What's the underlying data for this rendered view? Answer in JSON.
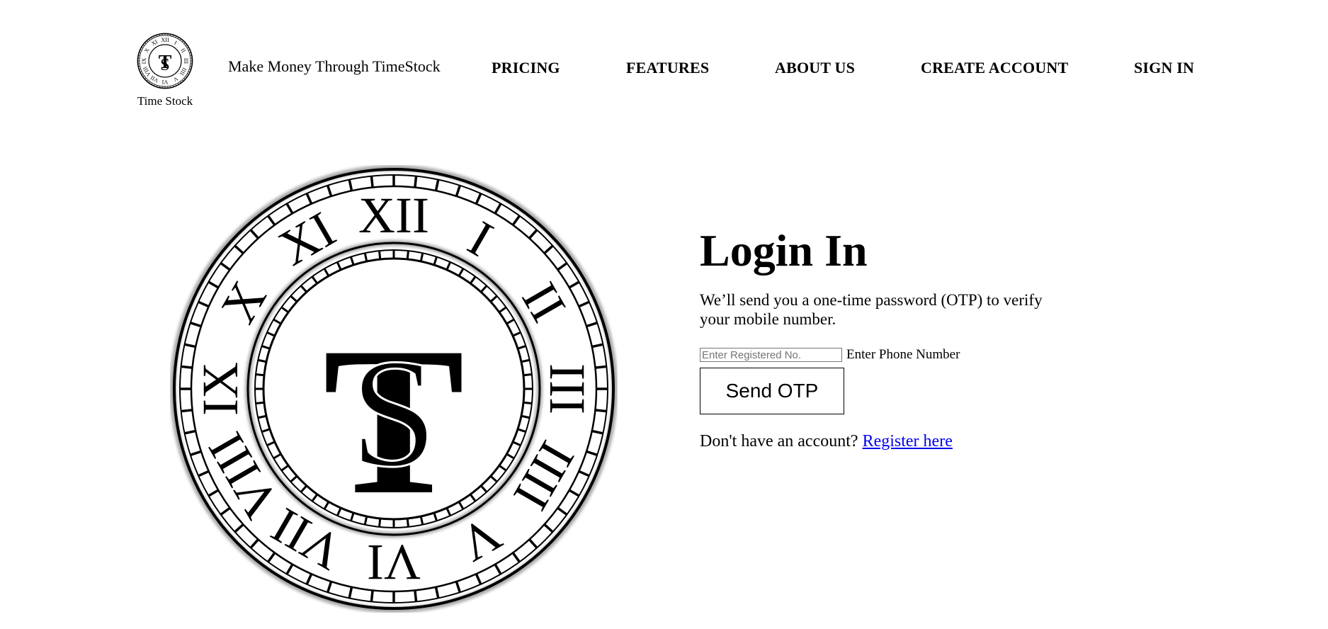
{
  "header": {
    "logo_text": "Time Stock",
    "logo_monogram": "TS",
    "tagline": "Make Money Through TimeStock",
    "nav": [
      {
        "label": "PRICING"
      },
      {
        "label": "FEATURES"
      },
      {
        "label": "ABOUT US"
      },
      {
        "label": "CREATE ACCOUNT"
      },
      {
        "label": "SIGN IN"
      }
    ]
  },
  "hero": {
    "numerals": [
      "XII",
      "I",
      "II",
      "III",
      "IIII",
      "V",
      "VI",
      "VII",
      "VIII",
      "IX",
      "X",
      "XI"
    ]
  },
  "login": {
    "title": "Login In",
    "description": "We’ll send you a one-time password (OTP) to verify your mobile number.",
    "phone_placeholder": "Enter Registered No.",
    "phone_value": "",
    "phone_label": "Enter Phone Number",
    "send_button": "Send OTP",
    "no_account_text": "Don't have an account?",
    "register_link": "Register here"
  },
  "colors": {
    "background": "#ffffff",
    "text": "#000000",
    "link": "#0000ee"
  }
}
